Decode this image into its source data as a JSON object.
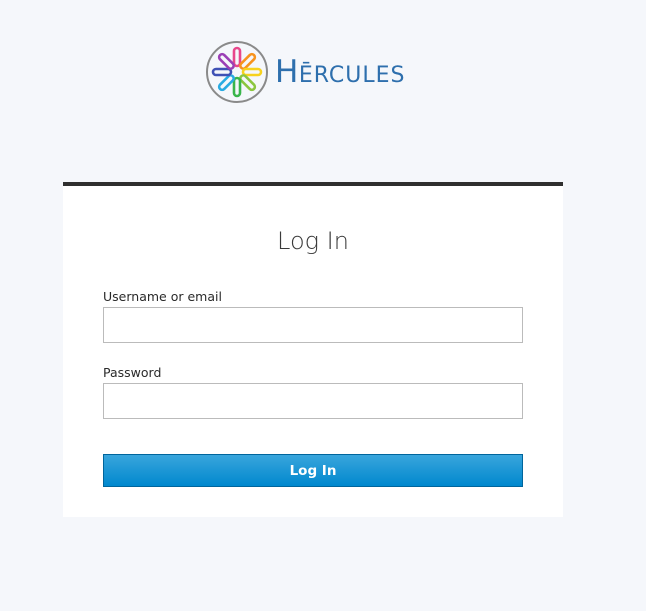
{
  "brand": {
    "name_first": "H",
    "name_rest": "ĒRCULES",
    "accent_color": "#2e6fad",
    "logo_icon": "hercules-rainbow-star-icon"
  },
  "login": {
    "title": "Log In",
    "username_label": "Username or email",
    "username_value": "",
    "password_label": "Password",
    "password_value": "",
    "submit_label": "Log In",
    "button_color": "#0088ce"
  }
}
